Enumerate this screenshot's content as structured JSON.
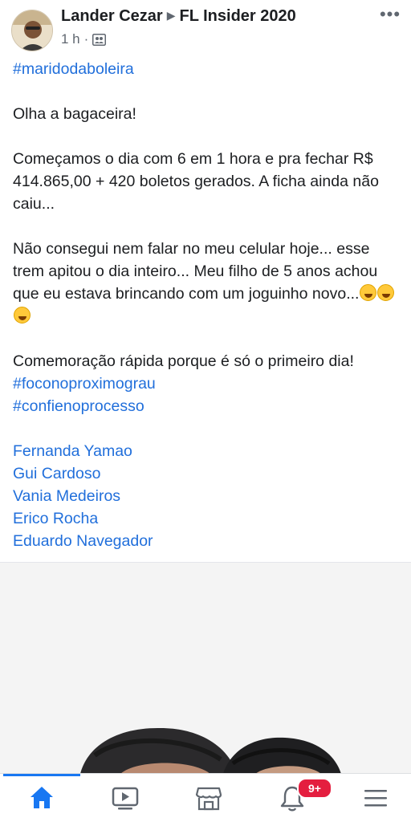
{
  "post": {
    "author": "Lander Cezar",
    "group": "FL Insider 2020",
    "time": "1 h",
    "separator": "·",
    "group_icon": "group-icon",
    "more_icon": "more-options-icon",
    "more_glyph": "•••"
  },
  "body": {
    "hashtag_top": "#maridodaboleira",
    "para1": "Olha a bagaceira!",
    "para2": "Começamos o dia com 6 em 1 hora e pra fechar R$ 414.865,00 + 420 boletos gerados. A ficha ainda não caiu...",
    "para3": "Não consegui nem falar no meu celular hoje... esse trem apitou o dia inteiro... Meu filho de 5 anos achou que eu estava brincando com um joguinho novo...",
    "para3_emoji": "rolling-on-floor-laughing-emoji",
    "para4": "Comemoração rápida porque é só o primeiro dia!",
    "hashtags": [
      "#foconoproximograu",
      "#confienoprocesso"
    ],
    "mentions": [
      "Fernanda Yamao",
      "Gui Cardoso",
      "Vania Medeiros",
      "Erico Rocha",
      "Eduardo Navegador"
    ]
  },
  "tab_bar": {
    "tabs": [
      "home-icon",
      "video-icon",
      "marketplace-icon",
      "notifications-icon",
      "menu-icon"
    ],
    "active": "home-icon",
    "notification_badge": "9+",
    "accent": "#1877f2",
    "badge_color": "#e41e3f"
  },
  "colors": {
    "link": "#216fdb",
    "text": "#1c1e21",
    "meta": "#606770"
  }
}
